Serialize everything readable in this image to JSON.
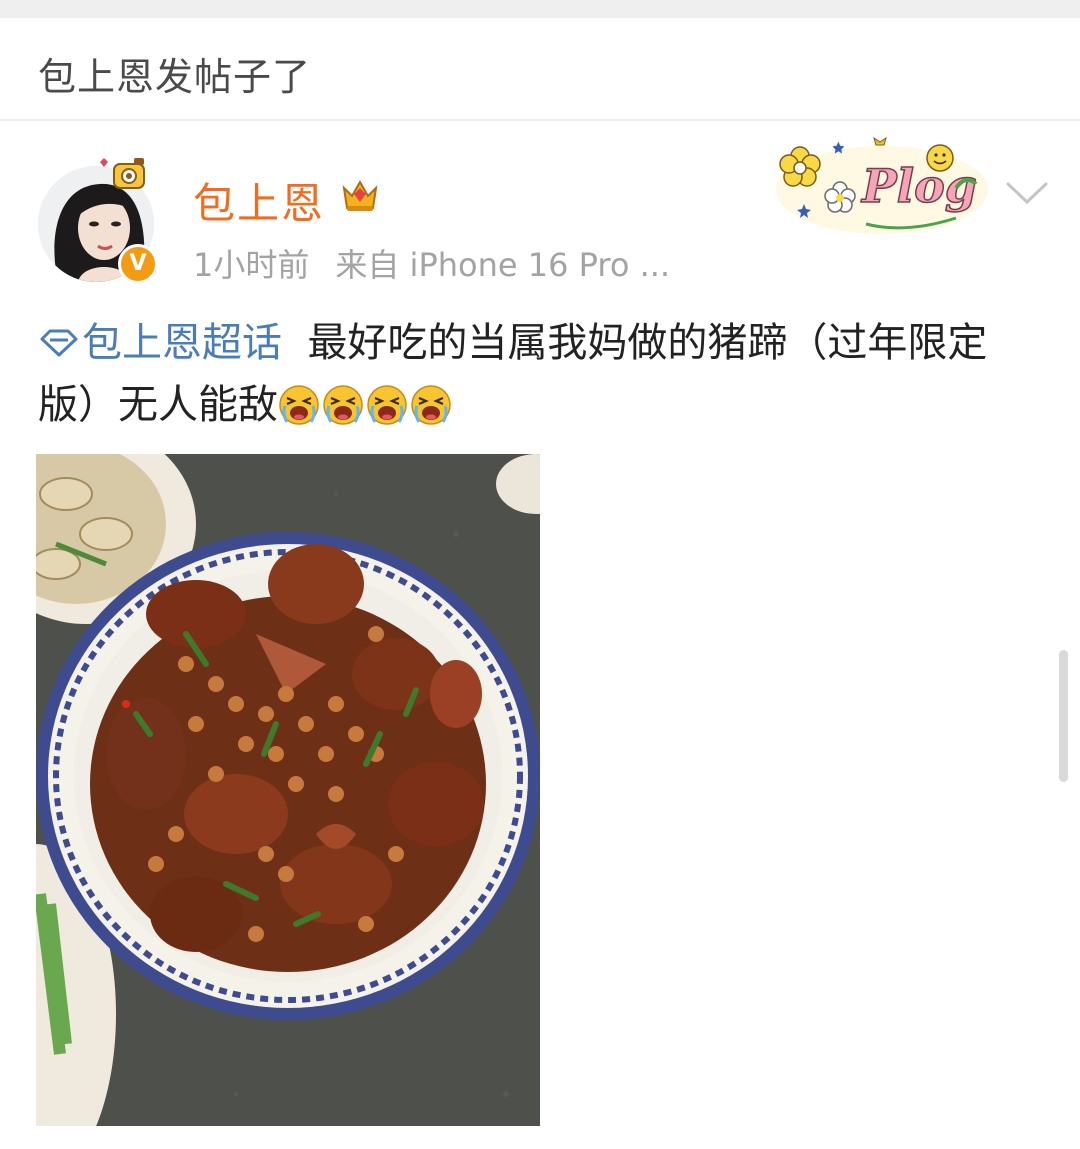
{
  "header": {
    "title": "包上恩发帖子了"
  },
  "post": {
    "author": {
      "name": "包上恩",
      "verified_mark": "V",
      "badge_icon": "gold-crown-badge-icon"
    },
    "meta": {
      "time": "1小时前",
      "source": "来自 iPhone 16 Pro ..."
    },
    "decoration": {
      "sticker_label": "Plog",
      "sticker_icon": "plog-flower-sticker-icon"
    },
    "topic": {
      "label": "包上恩超话",
      "icon": "diamond-topic-icon"
    },
    "text": "最好吃的当属我妈做的猪蹄（过年限定版）无人能敌",
    "emojis": [
      "crying-emoji-icon",
      "crying-emoji-icon",
      "crying-emoji-icon",
      "crying-emoji-icon"
    ],
    "image": {
      "icon": "braised-pig-trotters-photo"
    }
  },
  "colors": {
    "username": "#f26b1f",
    "topic": "#4a7cb8",
    "meta": "#a3a3a3",
    "body_text": "#222222",
    "verified": "#f39b12"
  }
}
